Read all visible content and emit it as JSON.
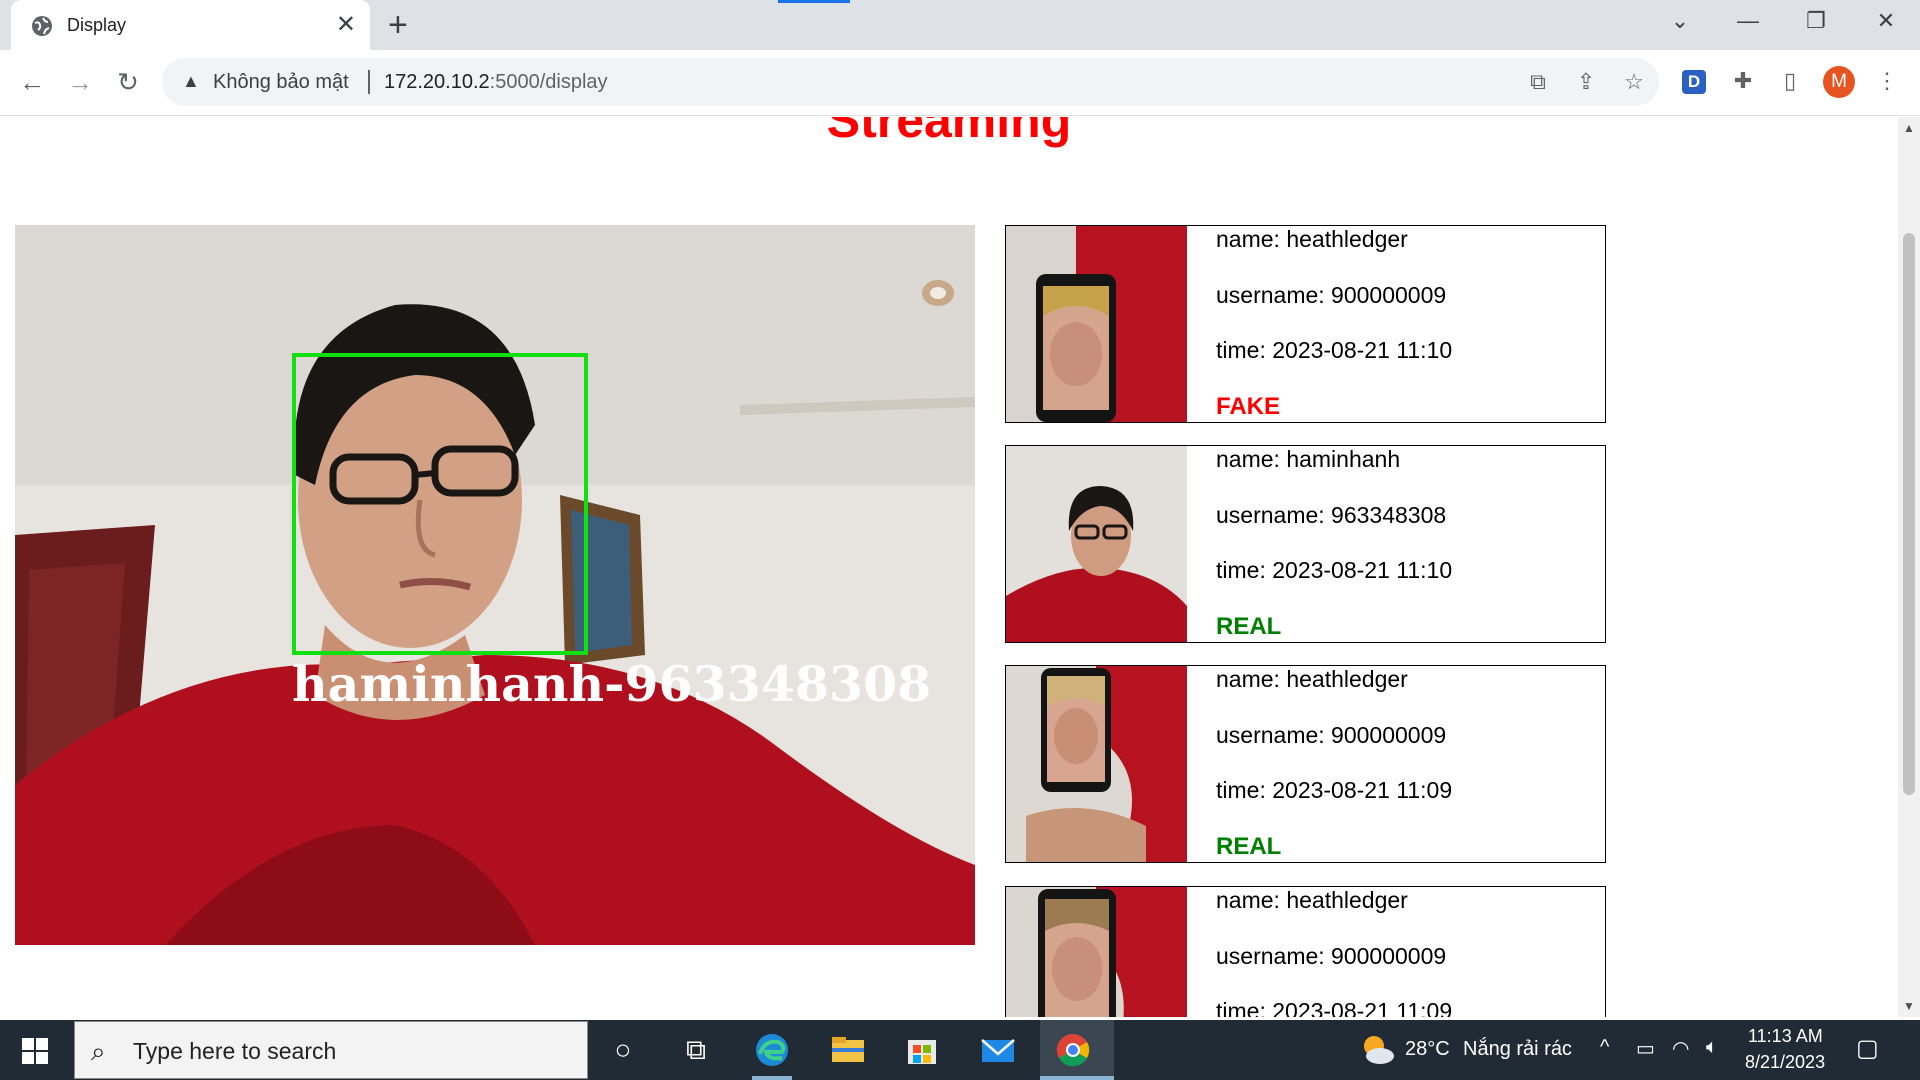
{
  "browser": {
    "tab_title": "Display",
    "new_tab_symbol": "+",
    "close_symbol": "✕",
    "security_label": "Không bảo mật",
    "url_host": "172.20.10.2",
    "url_path": ":5000/display",
    "avatar_initial": "M",
    "extension_letter": "D"
  },
  "page": {
    "title": "Streaming",
    "video_overlay_label": "haminhanh-963348308",
    "detections": [
      {
        "name": "name: heathledger",
        "username": "username: 900000009",
        "time": "time: 2023-08-21 11:10",
        "status": "FAKE"
      },
      {
        "name": "name: haminhanh",
        "username": "username: 963348308",
        "time": "time: 2023-08-21 11:10",
        "status": "REAL"
      },
      {
        "name": "name: heathledger",
        "username": "username: 900000009",
        "time": "time: 2023-08-21 11:09",
        "status": "REAL"
      },
      {
        "name": "name: heathledger",
        "username": "username: 900000009",
        "time": "time: 2023-08-21 11:09",
        "status": ""
      }
    ]
  },
  "taskbar": {
    "search_placeholder": "Type here to search",
    "weather_temp": "28°C",
    "weather_desc": "Nắng rải rác",
    "time": "11:13 AM",
    "date": "8/21/2023"
  },
  "colors": {
    "title_red": "#ff0000",
    "fake_red": "#ff0000",
    "real_green": "#008000",
    "face_box_green": "#10e010",
    "taskbar_bg": "#202b36"
  }
}
